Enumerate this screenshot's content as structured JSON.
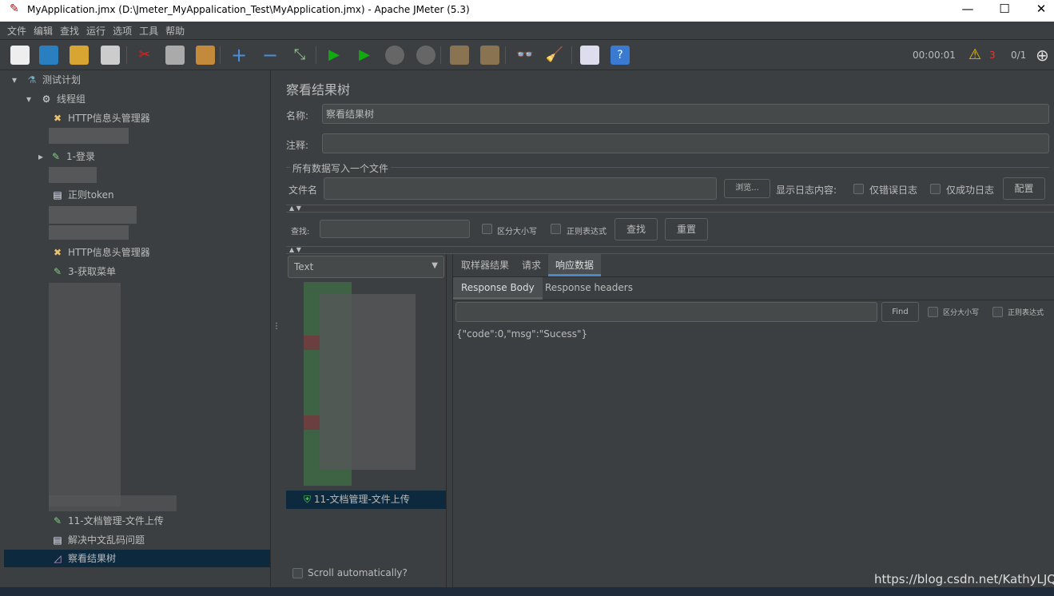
{
  "window": {
    "title": "MyApplication.jmx (D:\\Jmeter_MyAppalication_Test\\MyApplication.jmx) - Apache JMeter (5.3)",
    "minimize": "—",
    "maximize": "☐",
    "close": "✕"
  },
  "menu": [
    "文件",
    "编辑",
    "查找",
    "运行",
    "选项",
    "工具",
    "帮助"
  ],
  "toolbar": {
    "timer": "00:00:01",
    "warnings": "3",
    "threads": "0/1"
  },
  "tree": [
    {
      "label": "测试计划",
      "icon": "flask-icon"
    },
    {
      "label": "线程组",
      "icon": "gear-icon"
    },
    {
      "label": "HTTP信息头管理器",
      "icon": "tools-icon"
    },
    {
      "label": "1-登录",
      "icon": "pipette-icon"
    },
    {
      "label": "正则token",
      "icon": "document-icon"
    },
    {
      "label": "HTTP信息头管理器",
      "icon": "tools-icon"
    },
    {
      "label": "3-获取菜单",
      "icon": "pipette-icon"
    },
    {
      "label": "11-文档管理-文件上传",
      "icon": "pipette-icon"
    },
    {
      "label": "解决中文乱码问题",
      "icon": "document-icon"
    },
    {
      "label": "察看结果树",
      "icon": "chart-icon",
      "selected": true
    }
  ],
  "panel": {
    "title": "察看结果树",
    "name_label": "名称:",
    "name_value": "察看结果树",
    "comment_label": "注释:",
    "comment_value": "",
    "file_group": "所有数据写入一个文件",
    "filename_label": "文件名",
    "filename_value": "",
    "browse": "浏览...",
    "log_label": "显示日志内容:",
    "errors_only": "仅错误日志",
    "success_only": "仅成功日志",
    "configure": "配置",
    "search_label": "查找:",
    "search_value": "",
    "case_sensitive": "区分大小写",
    "regex": "正则表达式",
    "find": "查找",
    "reset": "重置",
    "renderer": "Text",
    "selected_result": "11-文档管理-文件上传",
    "scroll_auto": "Scroll automatically?",
    "tabs": [
      "取样器结果",
      "请求",
      "响应数据"
    ],
    "active_tab": "响应数据",
    "subtabs": [
      "Response Body",
      "Response headers"
    ],
    "active_subtab": "Response Body",
    "find_button": "Find",
    "find_case": "区分大小写",
    "find_regex": "正则表达式",
    "response_body": "{\"code\":0,\"msg\":\"Sucess\"}"
  },
  "watermark": "https://blog.csdn.net/KathyLJQ",
  "colors": {
    "bg": "#3c3f41",
    "input": "#45494a",
    "selected": "#0d293e",
    "accent": "#4a88c7",
    "success": "#3f6b45",
    "error": "#6b3f3f"
  }
}
